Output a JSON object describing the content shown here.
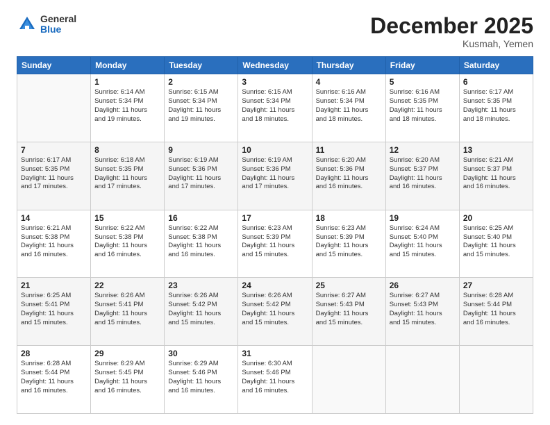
{
  "logo": {
    "general": "General",
    "blue": "Blue"
  },
  "header": {
    "month": "December 2025",
    "location": "Kusmah, Yemen"
  },
  "weekdays": [
    "Sunday",
    "Monday",
    "Tuesday",
    "Wednesday",
    "Thursday",
    "Friday",
    "Saturday"
  ],
  "weeks": [
    [
      {
        "day": "",
        "info": ""
      },
      {
        "day": "1",
        "info": "Sunrise: 6:14 AM\nSunset: 5:34 PM\nDaylight: 11 hours\nand 19 minutes."
      },
      {
        "day": "2",
        "info": "Sunrise: 6:15 AM\nSunset: 5:34 PM\nDaylight: 11 hours\nand 19 minutes."
      },
      {
        "day": "3",
        "info": "Sunrise: 6:15 AM\nSunset: 5:34 PM\nDaylight: 11 hours\nand 18 minutes."
      },
      {
        "day": "4",
        "info": "Sunrise: 6:16 AM\nSunset: 5:34 PM\nDaylight: 11 hours\nand 18 minutes."
      },
      {
        "day": "5",
        "info": "Sunrise: 6:16 AM\nSunset: 5:35 PM\nDaylight: 11 hours\nand 18 minutes."
      },
      {
        "day": "6",
        "info": "Sunrise: 6:17 AM\nSunset: 5:35 PM\nDaylight: 11 hours\nand 18 minutes."
      }
    ],
    [
      {
        "day": "7",
        "info": "Sunrise: 6:17 AM\nSunset: 5:35 PM\nDaylight: 11 hours\nand 17 minutes."
      },
      {
        "day": "8",
        "info": "Sunrise: 6:18 AM\nSunset: 5:35 PM\nDaylight: 11 hours\nand 17 minutes."
      },
      {
        "day": "9",
        "info": "Sunrise: 6:19 AM\nSunset: 5:36 PM\nDaylight: 11 hours\nand 17 minutes."
      },
      {
        "day": "10",
        "info": "Sunrise: 6:19 AM\nSunset: 5:36 PM\nDaylight: 11 hours\nand 17 minutes."
      },
      {
        "day": "11",
        "info": "Sunrise: 6:20 AM\nSunset: 5:36 PM\nDaylight: 11 hours\nand 16 minutes."
      },
      {
        "day": "12",
        "info": "Sunrise: 6:20 AM\nSunset: 5:37 PM\nDaylight: 11 hours\nand 16 minutes."
      },
      {
        "day": "13",
        "info": "Sunrise: 6:21 AM\nSunset: 5:37 PM\nDaylight: 11 hours\nand 16 minutes."
      }
    ],
    [
      {
        "day": "14",
        "info": "Sunrise: 6:21 AM\nSunset: 5:38 PM\nDaylight: 11 hours\nand 16 minutes."
      },
      {
        "day": "15",
        "info": "Sunrise: 6:22 AM\nSunset: 5:38 PM\nDaylight: 11 hours\nand 16 minutes."
      },
      {
        "day": "16",
        "info": "Sunrise: 6:22 AM\nSunset: 5:38 PM\nDaylight: 11 hours\nand 16 minutes."
      },
      {
        "day": "17",
        "info": "Sunrise: 6:23 AM\nSunset: 5:39 PM\nDaylight: 11 hours\nand 15 minutes."
      },
      {
        "day": "18",
        "info": "Sunrise: 6:23 AM\nSunset: 5:39 PM\nDaylight: 11 hours\nand 15 minutes."
      },
      {
        "day": "19",
        "info": "Sunrise: 6:24 AM\nSunset: 5:40 PM\nDaylight: 11 hours\nand 15 minutes."
      },
      {
        "day": "20",
        "info": "Sunrise: 6:25 AM\nSunset: 5:40 PM\nDaylight: 11 hours\nand 15 minutes."
      }
    ],
    [
      {
        "day": "21",
        "info": "Sunrise: 6:25 AM\nSunset: 5:41 PM\nDaylight: 11 hours\nand 15 minutes."
      },
      {
        "day": "22",
        "info": "Sunrise: 6:26 AM\nSunset: 5:41 PM\nDaylight: 11 hours\nand 15 minutes."
      },
      {
        "day": "23",
        "info": "Sunrise: 6:26 AM\nSunset: 5:42 PM\nDaylight: 11 hours\nand 15 minutes."
      },
      {
        "day": "24",
        "info": "Sunrise: 6:26 AM\nSunset: 5:42 PM\nDaylight: 11 hours\nand 15 minutes."
      },
      {
        "day": "25",
        "info": "Sunrise: 6:27 AM\nSunset: 5:43 PM\nDaylight: 11 hours\nand 15 minutes."
      },
      {
        "day": "26",
        "info": "Sunrise: 6:27 AM\nSunset: 5:43 PM\nDaylight: 11 hours\nand 15 minutes."
      },
      {
        "day": "27",
        "info": "Sunrise: 6:28 AM\nSunset: 5:44 PM\nDaylight: 11 hours\nand 16 minutes."
      }
    ],
    [
      {
        "day": "28",
        "info": "Sunrise: 6:28 AM\nSunset: 5:44 PM\nDaylight: 11 hours\nand 16 minutes."
      },
      {
        "day": "29",
        "info": "Sunrise: 6:29 AM\nSunset: 5:45 PM\nDaylight: 11 hours\nand 16 minutes."
      },
      {
        "day": "30",
        "info": "Sunrise: 6:29 AM\nSunset: 5:46 PM\nDaylight: 11 hours\nand 16 minutes."
      },
      {
        "day": "31",
        "info": "Sunrise: 6:30 AM\nSunset: 5:46 PM\nDaylight: 11 hours\nand 16 minutes."
      },
      {
        "day": "",
        "info": ""
      },
      {
        "day": "",
        "info": ""
      },
      {
        "day": "",
        "info": ""
      }
    ]
  ]
}
